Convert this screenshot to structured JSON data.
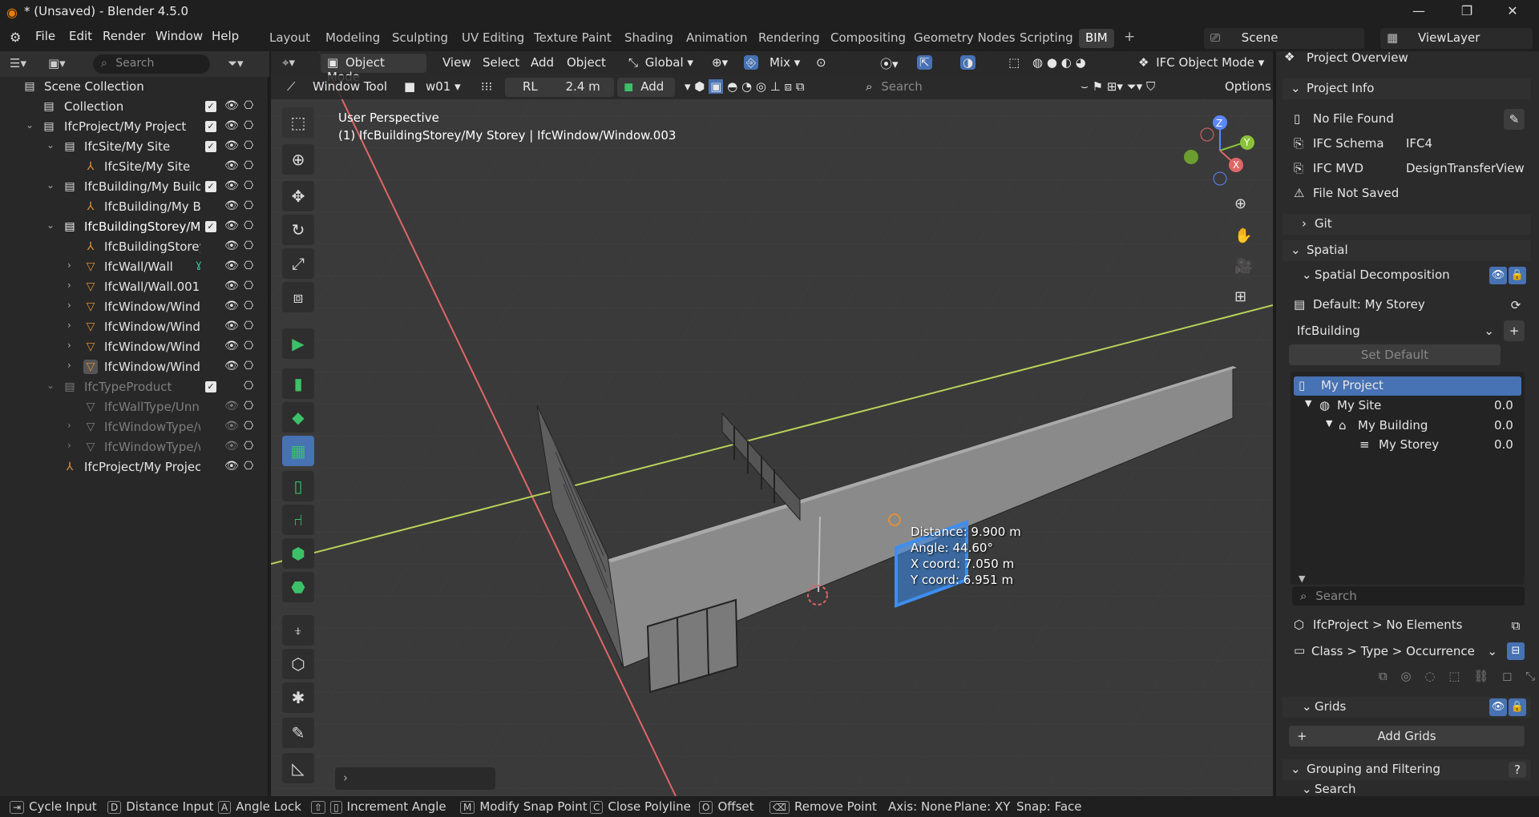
{
  "window": {
    "title": "* (Unsaved) - Blender 4.5.0"
  },
  "menus": [
    "File",
    "Edit",
    "Render",
    "Window",
    "Help"
  ],
  "workspaces": [
    "Layout",
    "Modeling",
    "Sculpting",
    "UV Editing",
    "Texture Paint",
    "Shading",
    "Animation",
    "Rendering",
    "Compositing",
    "Geometry Nodes",
    "Scripting",
    "BIM"
  ],
  "active_workspace": "BIM",
  "scene": "Scene",
  "view_layer": "ViewLayer",
  "outliner": {
    "search_placeholder": "Search",
    "rows": [
      {
        "label": "Scene Collection",
        "indent": 0
      },
      {
        "label": "Collection",
        "indent": 1
      },
      {
        "label": "IfcProject/My Project",
        "indent": 1
      },
      {
        "label": "IfcSite/My Site",
        "indent": 2
      },
      {
        "label": "IfcSite/My Site",
        "indent": 3
      },
      {
        "label": "IfcBuilding/My Building",
        "indent": 2
      },
      {
        "label": "IfcBuilding/My Bui",
        "indent": 3
      },
      {
        "label": "IfcBuildingStorey/My S",
        "indent": 2
      },
      {
        "label": "IfcBuildingStorey/I",
        "indent": 3
      },
      {
        "label": "IfcWall/Wall",
        "indent": 3
      },
      {
        "label": "IfcWall/Wall.001",
        "indent": 3
      },
      {
        "label": "IfcWindow/Window",
        "indent": 3
      },
      {
        "label": "IfcWindow/Window",
        "indent": 3
      },
      {
        "label": "IfcWindow/Window",
        "indent": 3
      },
      {
        "label": "IfcWindow/Window",
        "indent": 3
      },
      {
        "label": "IfcTypeProduct",
        "indent": 2
      },
      {
        "label": "IfcWallType/Unna",
        "indent": 3
      },
      {
        "label": "IfcWindowType/w",
        "indent": 3
      },
      {
        "label": "IfcWindowType/w",
        "indent": 3
      },
      {
        "label": "IfcProject/My Project",
        "indent": 1
      }
    ]
  },
  "viewport": {
    "mode": "Object Mode",
    "menu": [
      "View",
      "Select",
      "Add",
      "Object"
    ],
    "orientation": "Global",
    "snap": "Mix",
    "ifc_mode": "IFC Object Mode",
    "tool_name": "Window Tool",
    "type_name": "w01",
    "rl_label": "RL",
    "rl_value": "2.4 m",
    "add_label": "Add",
    "search_placeholder": "Search",
    "options_label": "Options",
    "perspective": "User Perspective",
    "context": "(1) IfcBuildingStorey/My Storey | IfcWindow/Window.003",
    "measure": {
      "distance": "Distance: 9.900 m",
      "angle": "Angle: 44.60°",
      "x": "X coord: 7.050 m",
      "y": "Y coord: 6.951 m"
    },
    "gizmo": {
      "x": "X",
      "y": "Y",
      "z": "Z"
    }
  },
  "properties": {
    "tab": "Project Overview",
    "project_info": "Project Info",
    "no_file": "No File Found",
    "schema_label": "IFC Schema",
    "schema_value": "IFC4",
    "mvd_label": "IFC MVD",
    "mvd_value": "DesignTransferView",
    "not_saved": "File Not Saved",
    "git": "Git",
    "spatial": "Spatial",
    "spatial_decomp": "Spatial Decomposition",
    "default_storey": "Default: My Storey",
    "building_select": "IfcBuilding",
    "set_default": "Set Default",
    "tree": [
      {
        "name": "My Project",
        "value": ""
      },
      {
        "name": "My Site",
        "value": "0.0"
      },
      {
        "name": "My Building",
        "value": "0.0"
      },
      {
        "name": "My Storey",
        "value": "0.0"
      }
    ],
    "search_placeholder": "Search",
    "no_elements": "IfcProject > No Elements",
    "class_type": "Class > Type > Occurrence",
    "grids": "Grids",
    "add_grids": "Add Grids",
    "grouping": "Grouping and Filtering",
    "search_section": "Search"
  },
  "statusbar": {
    "items": [
      "Cycle Input",
      "Distance Input",
      "Angle Lock",
      "Increment Angle",
      "Modify Snap Point",
      "Close Polyline",
      "Offset",
      "Remove Point",
      "Axis: None",
      "Plane: XY",
      "Snap: Face"
    ],
    "keys": [
      "D",
      "A",
      "M",
      "C",
      "O"
    ]
  },
  "colors": {
    "accent": "#4772b3",
    "x_axis": "#e06666",
    "y_axis": "#b7d35a",
    "window_sel": "#3d8ef0"
  }
}
